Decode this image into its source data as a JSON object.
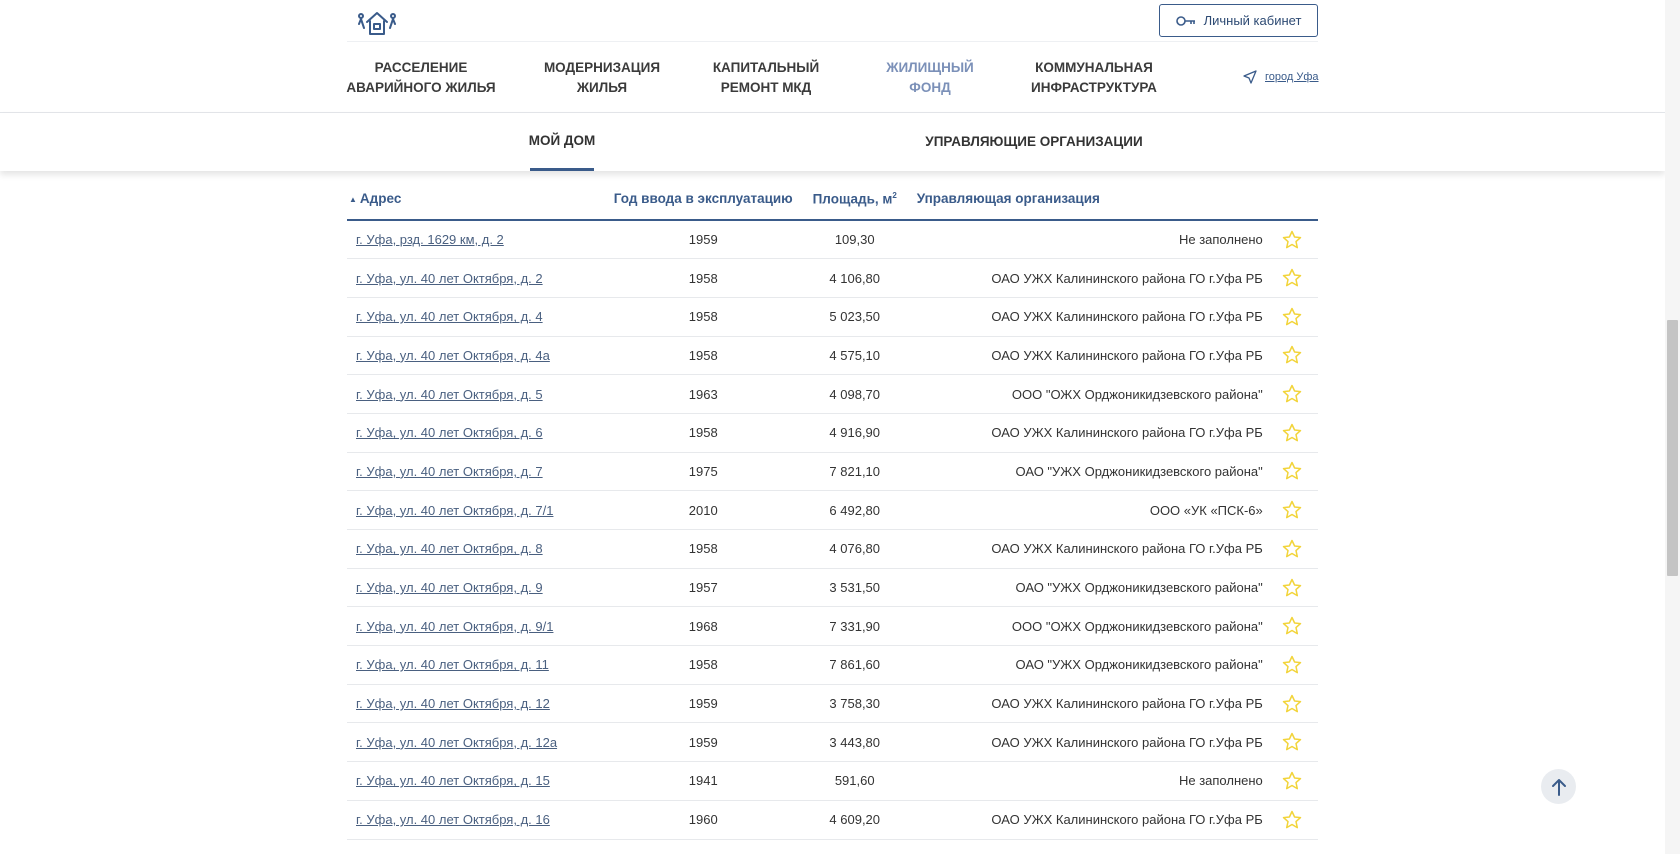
{
  "header": {
    "logo_icon": "house-people-logo-icon",
    "cabinet_label": "Личный кабинет",
    "cabinet_icon": "key-icon",
    "city_label": "город Уфа",
    "city_icon": "location-arrow-icon"
  },
  "nav": [
    {
      "line1": "РАССЕЛЕНИЕ",
      "line2": "АВАРИЙНОГО ЖИЛЬЯ"
    },
    {
      "line1": "МОДЕРНИЗАЦИЯ",
      "line2": "ЖИЛЬЯ"
    },
    {
      "line1": "КАПИТАЛЬНЫЙ",
      "line2": "РЕМОНТ МКД"
    },
    {
      "line1": "ЖИЛИЩНЫЙ",
      "line2": "ФОНД"
    },
    {
      "line1": "КОММУНАЛЬНАЯ",
      "line2": "ИНФРАСТРУКТУРА"
    }
  ],
  "subnav": {
    "my_home": "МОЙ ДОМ",
    "management": "УПРАВЛЯЮЩИЕ ОРГАНИЗАЦИИ"
  },
  "table": {
    "headers": {
      "address": "Адрес",
      "year": "Год ввода в эксплуатацию",
      "area": "Площадь, м",
      "area_sup": "2",
      "org": "Управляющая организация"
    },
    "rows": [
      {
        "address": "г. Уфа, рзд. 1629 км, д. 2",
        "year": "1959",
        "area": "109,30",
        "org": "Не заполнено"
      },
      {
        "address": "г. Уфа, ул. 40 лет Октября, д. 2",
        "year": "1958",
        "area": "4 106,80",
        "org": "ОАО УЖХ Калининского района ГО г.Уфа РБ"
      },
      {
        "address": "г. Уфа, ул. 40 лет Октября, д. 4",
        "year": "1958",
        "area": "5 023,50",
        "org": "ОАО УЖХ Калининского района ГО г.Уфа РБ"
      },
      {
        "address": "г. Уфа, ул. 40 лет Октября, д. 4а",
        "year": "1958",
        "area": "4 575,10",
        "org": "ОАО УЖХ Калининского района ГО г.Уфа РБ"
      },
      {
        "address": "г. Уфа, ул. 40 лет Октября, д. 5",
        "year": "1963",
        "area": "4 098,70",
        "org": "ООО \"ОЖХ Орджоникидзевского района\""
      },
      {
        "address": "г. Уфа, ул. 40 лет Октября, д. 6",
        "year": "1958",
        "area": "4 916,90",
        "org": "ОАО УЖХ Калининского района ГО г.Уфа РБ"
      },
      {
        "address": "г. Уфа, ул. 40 лет Октября, д. 7",
        "year": "1975",
        "area": "7 821,10",
        "org": "ОАО \"УЖХ Орджоникидзевского района\""
      },
      {
        "address": "г. Уфа, ул. 40 лет Октября, д. 7/1",
        "year": "2010",
        "area": "6 492,80",
        "org": "ООО «УК «ПСК-6»"
      },
      {
        "address": "г. Уфа, ул. 40 лет Октября, д. 8",
        "year": "1958",
        "area": "4 076,80",
        "org": "ОАО УЖХ Калининского района ГО г.Уфа РБ"
      },
      {
        "address": "г. Уфа, ул. 40 лет Октября, д. 9",
        "year": "1957",
        "area": "3 531,50",
        "org": "ОАО \"УЖХ Орджоникидзевского района\""
      },
      {
        "address": "г. Уфа, ул. 40 лет Октября, д. 9/1",
        "year": "1968",
        "area": "7 331,90",
        "org": "ООО \"ОЖХ Орджоникидзевского района\""
      },
      {
        "address": "г. Уфа, ул. 40 лет Октября, д. 11",
        "year": "1958",
        "area": "7 861,60",
        "org": "ОАО \"УЖХ Орджоникидзевского района\""
      },
      {
        "address": "г. Уфа, ул. 40 лет Октября, д. 12",
        "year": "1959",
        "area": "3 758,30",
        "org": "ОАО УЖХ Калининского района ГО г.Уфа РБ"
      },
      {
        "address": "г. Уфа, ул. 40 лет Октября, д. 12а",
        "year": "1959",
        "area": "3 443,80",
        "org": "ОАО УЖХ Калининского района ГО г.Уфа РБ"
      },
      {
        "address": "г. Уфа, ул. 40 лет Октября, д. 15",
        "year": "1941",
        "area": "591,60",
        "org": "Не заполнено"
      },
      {
        "address": "г. Уфа, ул. 40 лет Октября, д. 16",
        "year": "1960",
        "area": "4 609,20",
        "org": "ОАО УЖХ Калининского района ГО г.Уфа РБ"
      }
    ]
  },
  "colors": {
    "accent": "#3a5b8a",
    "nav_active": "#7b90b8",
    "star": "#f2d43a"
  },
  "scroll_top_icon": "arrow-up-icon",
  "favorite_icon": "star-icon"
}
